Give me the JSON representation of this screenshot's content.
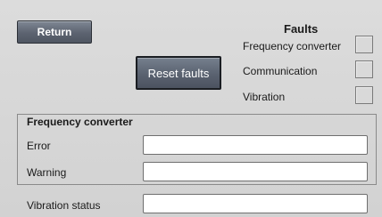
{
  "buttons": {
    "return_label": "Return",
    "reset_label": "Reset faults"
  },
  "faults": {
    "title": "Faults",
    "items": [
      {
        "label": "Frequency converter",
        "active": false
      },
      {
        "label": "Communication",
        "active": false
      },
      {
        "label": "Vibration",
        "active": false
      }
    ]
  },
  "frequency_converter": {
    "title": "Frequency converter",
    "rows": [
      {
        "label": "Error",
        "value": ""
      },
      {
        "label": "Warning",
        "value": ""
      }
    ]
  },
  "vibration": {
    "label": "Vibration status",
    "value": ""
  },
  "colors": {
    "background": "#d6d6d6",
    "button": "#5c6370",
    "indicator_off": "#d9d9d9"
  }
}
